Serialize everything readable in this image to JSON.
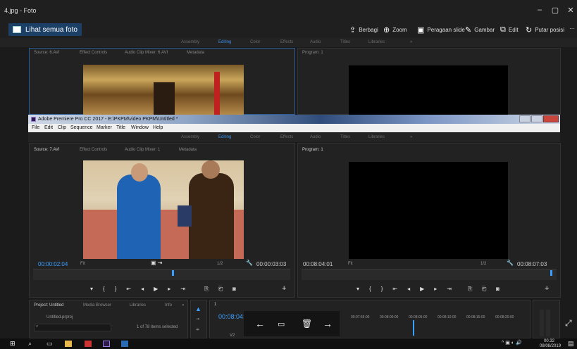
{
  "photos": {
    "title": "4.jpg - Foto",
    "see_all": "Lihat semua foto",
    "toolbar": [
      {
        "icon": "share-icon",
        "label": "Berbagi"
      },
      {
        "icon": "zoom-icon",
        "label": "Zoom"
      },
      {
        "icon": "slideshow-icon",
        "label": "Peragaan slide"
      },
      {
        "icon": "draw-icon",
        "label": "Gambar"
      },
      {
        "icon": "edit-icon",
        "label": "Edit"
      },
      {
        "icon": "rotate-icon",
        "label": "Putar posisi"
      }
    ],
    "more": "···",
    "win_min": "–",
    "win_max": "▢",
    "win_close": "✕"
  },
  "workspaces": [
    "Assembly",
    "Editing",
    "Color",
    "Effects",
    "Audio",
    "Titles",
    "Libraries",
    "»"
  ],
  "bg": {
    "source_tabs": [
      "Source: 6.AVI",
      "Effect Controls",
      "Audio Clip Mixer: 6.AVI",
      "Metadata"
    ],
    "program": "Program: 1"
  },
  "premiere": {
    "title": "Adobe Premiere Pro CC 2017 - E:\\PKPM\\video PKPM\\Untitled *",
    "menu": [
      "File",
      "Edit",
      "Clip",
      "Sequence",
      "Marker",
      "Title",
      "Window",
      "Help"
    ],
    "source_tabs": [
      "Source: 7.AVI",
      "Effect Controls",
      "Audio Clip Mixer: 1",
      "Metadata"
    ],
    "program": "Program: 1",
    "source_tc": "00:00:02:04",
    "source_fit": "Fit",
    "source_scale": "1/2",
    "source_dur": "00:00:03:03",
    "program_tc": "00:08:04:01",
    "program_fit": "Fit",
    "program_scale": "1/2",
    "program_dur": "00:08:07:03",
    "project_tabs": [
      "Project: Untitled",
      "Media Browser",
      "Libraries",
      "Info",
      "»"
    ],
    "project_file": "Untitled.prproj",
    "items_selected": "1 of 78 items selected",
    "seq_tab": "1",
    "seq_tc": "00:08:04:01",
    "ruler_times": [
      "00:07:55:00",
      "00:08:00:00",
      "00:08:05:00",
      "00:08:10:00",
      "00:08:15:00",
      "00:08:20:00"
    ],
    "track": "V2"
  },
  "taskbar": {
    "time": "00.32",
    "date": "08/08/2019"
  }
}
